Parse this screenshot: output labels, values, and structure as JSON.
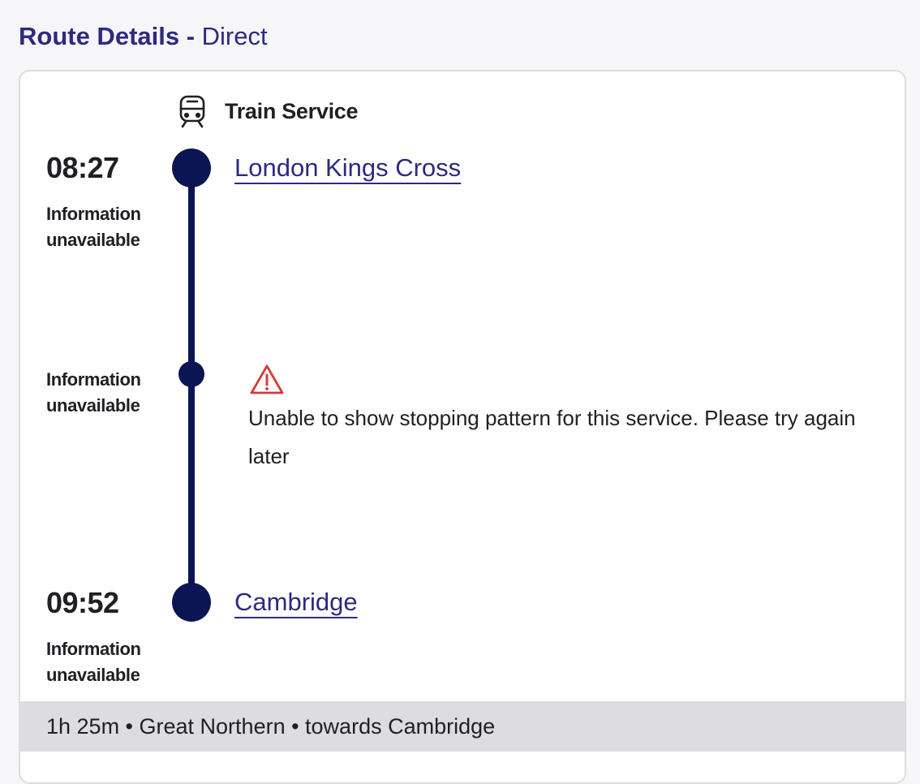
{
  "header": {
    "title_bold": "Route Details -",
    "title_rest": "Direct"
  },
  "service": {
    "icon": "train-icon",
    "label": "Train Service"
  },
  "origin": {
    "time": "08:27",
    "info": "Information unavailable",
    "station": "London Kings Cross"
  },
  "intermediate": {
    "info": "Information unavailable",
    "warning_icon": "warning-triangle-icon",
    "warning_color": "#d93a3a",
    "message": "Unable to show stopping pattern for this service. Please try again later"
  },
  "destination": {
    "time": "09:52",
    "info": "Information unavailable",
    "station": "Cambridge"
  },
  "summary": {
    "text": "1h 25m • Great Northern • towards Cambridge"
  },
  "colors": {
    "accent": "#2d2a80",
    "timeline": "#0b1553",
    "summary_bg": "#dcdce1"
  }
}
